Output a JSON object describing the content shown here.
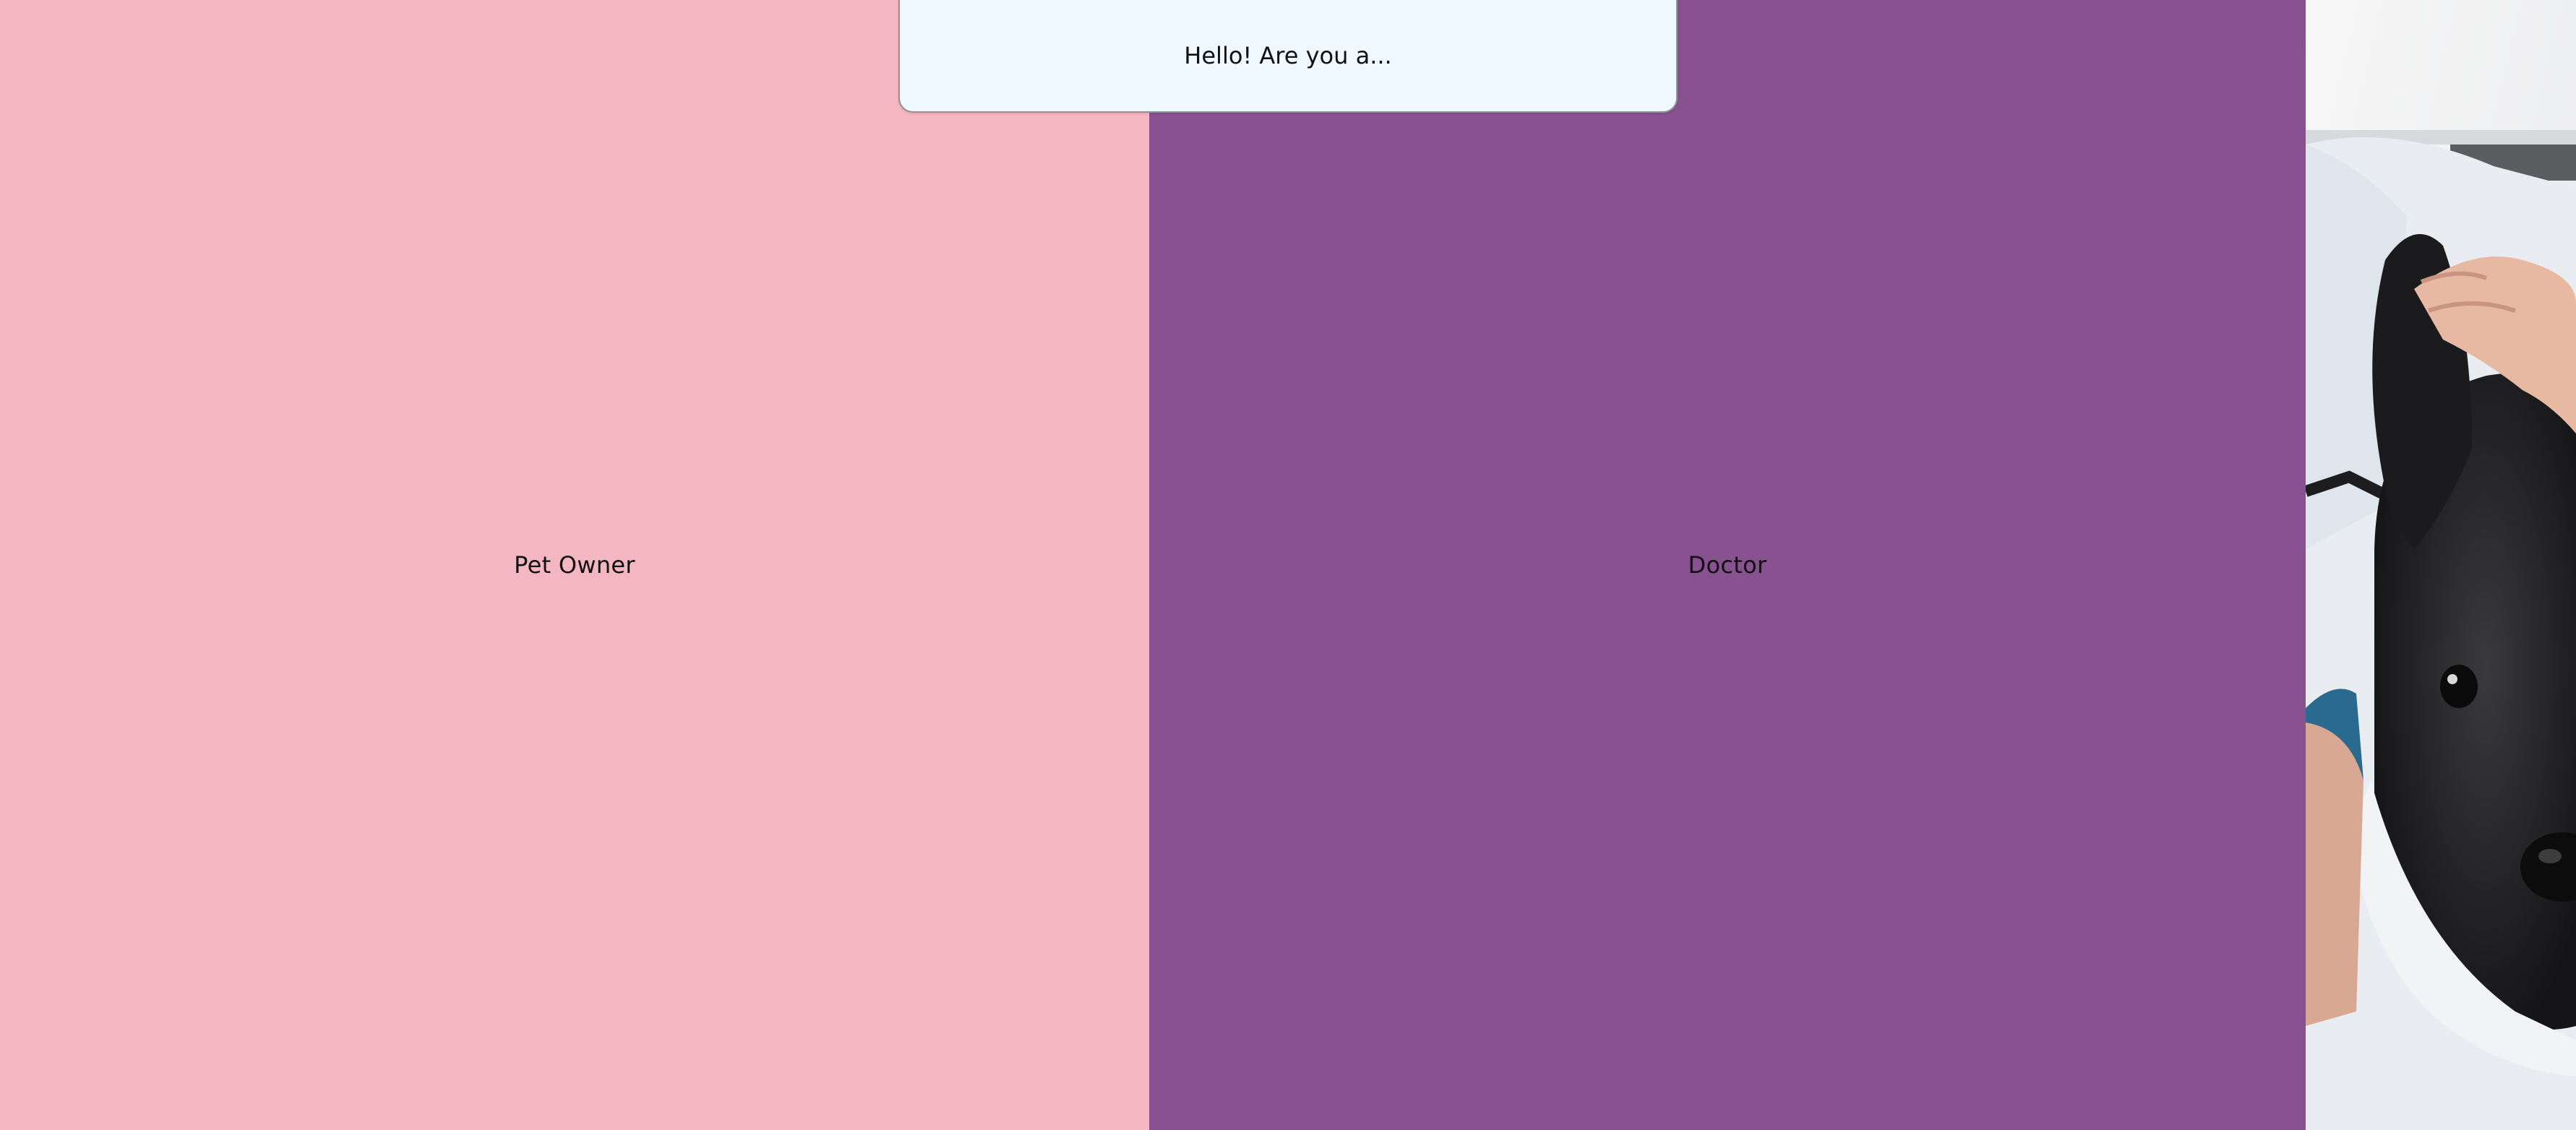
{
  "greeting": {
    "text": "Hello! Are you a..."
  },
  "roles": {
    "pet_owner": {
      "label": "Pet Owner",
      "color": "#f4b6c0"
    },
    "doctor": {
      "label": "Doctor",
      "color": "#88518f"
    }
  },
  "photo": {
    "icon": "vet-with-dog-photo"
  },
  "colors": {
    "card_background": "#eff8ff",
    "text": "#111111"
  }
}
